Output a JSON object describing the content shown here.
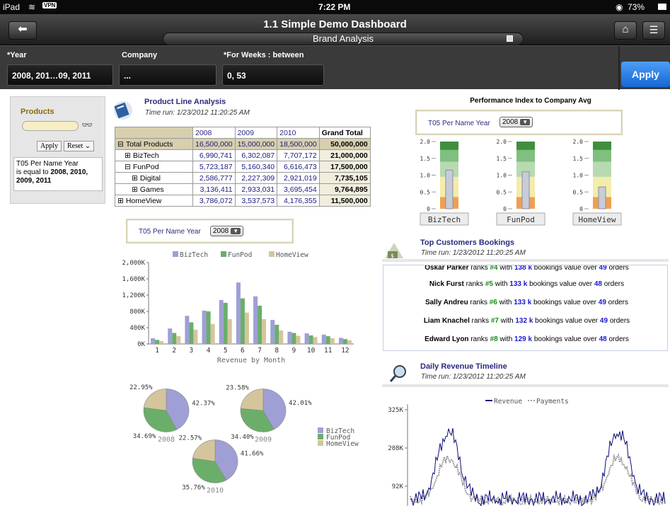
{
  "status": {
    "device": "iPad",
    "vpn": "VPN",
    "time": "7:22 PM",
    "battery": "73%"
  },
  "nav": {
    "title": "1.1 Simple Demo Dashboard",
    "subtitle": "Brand Analysis"
  },
  "prompts": {
    "year_label": "*Year",
    "year_value": "2008, 201…09, 2011",
    "company_label": "Company",
    "company_value": "...",
    "weeks_label": "*For Weeks : between",
    "weeks_value": "0, 53",
    "apply": "Apply"
  },
  "left_panel": {
    "title": "Products",
    "apply": "Apply",
    "reset": "Reset",
    "filter_prefix": "T05 Per Name Year",
    "filter_mid": "is equal to",
    "filter_values": "2008, 2010, 2009, 2011"
  },
  "product_line": {
    "title": "Product Line Analysis",
    "time_run": "Time run: 1/23/2012 11:20:25 AM",
    "columns": [
      "2008",
      "2009",
      "2010",
      "Grand Total"
    ],
    "rows": [
      {
        "label": "Total Products",
        "expander": "⊟",
        "indent": 0,
        "values": [
          "16,500,000",
          "15,000,000",
          "18,500,000",
          "50,000,000"
        ]
      },
      {
        "label": "BizTech",
        "expander": "⊞",
        "indent": 1,
        "values": [
          "6,990,741",
          "6,302,087",
          "7,707,172",
          "21,000,000"
        ]
      },
      {
        "label": "FunPod",
        "expander": "⊟",
        "indent": 1,
        "values": [
          "5,723,187",
          "5,160,340",
          "6,616,473",
          "17,500,000"
        ]
      },
      {
        "label": "Digital",
        "expander": "⊞",
        "indent": 2,
        "values": [
          "2,586,777",
          "2,227,309",
          "2,921,019",
          "7,735,105"
        ]
      },
      {
        "label": "Games",
        "expander": "⊞",
        "indent": 2,
        "values": [
          "3,136,411",
          "2,933,031",
          "3,695,454",
          "9,764,895"
        ]
      },
      {
        "label": "HomeView",
        "expander": "⊞",
        "indent": 0,
        "values": [
          "3,786,072",
          "3,537,573",
          "4,176,355",
          "11,500,000"
        ]
      }
    ]
  },
  "year_selector": {
    "label": "T05 Per Name Year",
    "value": "2008"
  },
  "chart_data": [
    {
      "type": "bar",
      "xlabel": "Revenue by Month",
      "categories": [
        "1",
        "2",
        "3",
        "4",
        "5",
        "6",
        "7",
        "8",
        "9",
        "10",
        "11",
        "12"
      ],
      "ylim": [
        0,
        2000
      ],
      "yticks": [
        "0K",
        "400K",
        "800K",
        "1,200K",
        "1,600K",
        "2,000K"
      ],
      "legend_position": "top",
      "series": [
        {
          "name": "BizTech",
          "color": "#9f9fd6",
          "values": [
            140,
            380,
            690,
            820,
            1080,
            1510,
            1170,
            590,
            300,
            260,
            230,
            150
          ]
        },
        {
          "name": "FunPod",
          "color": "#6aae6a",
          "values": [
            100,
            270,
            530,
            800,
            1010,
            1120,
            940,
            470,
            270,
            210,
            190,
            120
          ]
        },
        {
          "name": "HomeView",
          "color": "#d4c59c",
          "values": [
            70,
            190,
            350,
            490,
            610,
            770,
            610,
            330,
            200,
            170,
            140,
            90
          ]
        }
      ]
    },
    {
      "type": "pie",
      "charts": [
        {
          "year": "2008",
          "slices": [
            {
              "name": "BizTech",
              "value": 42.37,
              "label": "42.37%"
            },
            {
              "name": "FunPod",
              "value": 34.69,
              "label": "34.69%"
            },
            {
              "name": "HomeView",
              "value": 22.95,
              "label": "22.95%"
            }
          ]
        },
        {
          "year": "2009",
          "slices": [
            {
              "name": "BizTech",
              "value": 42.01,
              "label": "42.01%"
            },
            {
              "name": "FunPod",
              "value": 34.4,
              "label": "34.40%"
            },
            {
              "name": "HomeView",
              "value": 23.58,
              "label": "23.58%"
            }
          ]
        },
        {
          "year": "2010",
          "slices": [
            {
              "name": "BizTech",
              "value": 41.66,
              "label": "41.66%"
            },
            {
              "name": "FunPod",
              "value": 35.76,
              "label": "35.76%"
            },
            {
              "name": "HomeView",
              "value": 22.57,
              "label": "22.57%"
            }
          ]
        }
      ],
      "legend": [
        "BizTech",
        "FunPod",
        "HomeView"
      ],
      "colors": [
        "#9f9fd6",
        "#6aae6a",
        "#d4c59c"
      ]
    },
    {
      "type": "bar",
      "title": "Performance Index to Company Avg",
      "yticks": [
        "0",
        "0.5",
        "1.0",
        "1.5",
        "2.0"
      ],
      "ylim": [
        0,
        2.0
      ],
      "gauges": [
        {
          "name": "BizTech",
          "value": 1.15
        },
        {
          "name": "FunPod",
          "value": 1.1
        },
        {
          "name": "HomeView",
          "value": 0.65
        }
      ]
    },
    {
      "type": "line",
      "legend": [
        "Revenue",
        "Payments"
      ],
      "yticks": [
        "92K",
        "208K",
        "325K"
      ],
      "colors": {
        "revenue": "#0b0b7a",
        "payments": "#9a9a9a"
      }
    }
  ],
  "performance": {
    "title": "Performance Index to Company Avg",
    "selector_label": "T05 Per Name Year",
    "selector_value": "2008"
  },
  "top_customers": {
    "title": "Top Customers Bookings",
    "time_run": "Time run: 1/23/2012 11:20:25 AM",
    "partial": {
      "name": "Oskar Parker",
      "rank": "#4",
      "value": "138",
      "orders": "49"
    },
    "rows": [
      {
        "name": "Nick Furst",
        "rank": "#5",
        "value": "133",
        "orders": "48"
      },
      {
        "name": "Sally Andreu",
        "rank": "#6",
        "value": "133",
        "orders": "49"
      },
      {
        "name": "Liam Knachel",
        "rank": "#7",
        "value": "132",
        "orders": "49"
      },
      {
        "name": "Edward Lyon",
        "rank": "#8",
        "value": "129",
        "orders": "48"
      }
    ],
    "t_ranks": "ranks",
    "t_with": "with",
    "t_k": "k",
    "t_bookings": "bookings value over",
    "t_orders": "orders"
  },
  "daily_revenue": {
    "title": "Daily Revenue Timeline",
    "time_run": "Time run: 1/23/2012 11:20:25 AM",
    "legend_revenue": "Revenue",
    "legend_payments": "Payments"
  }
}
